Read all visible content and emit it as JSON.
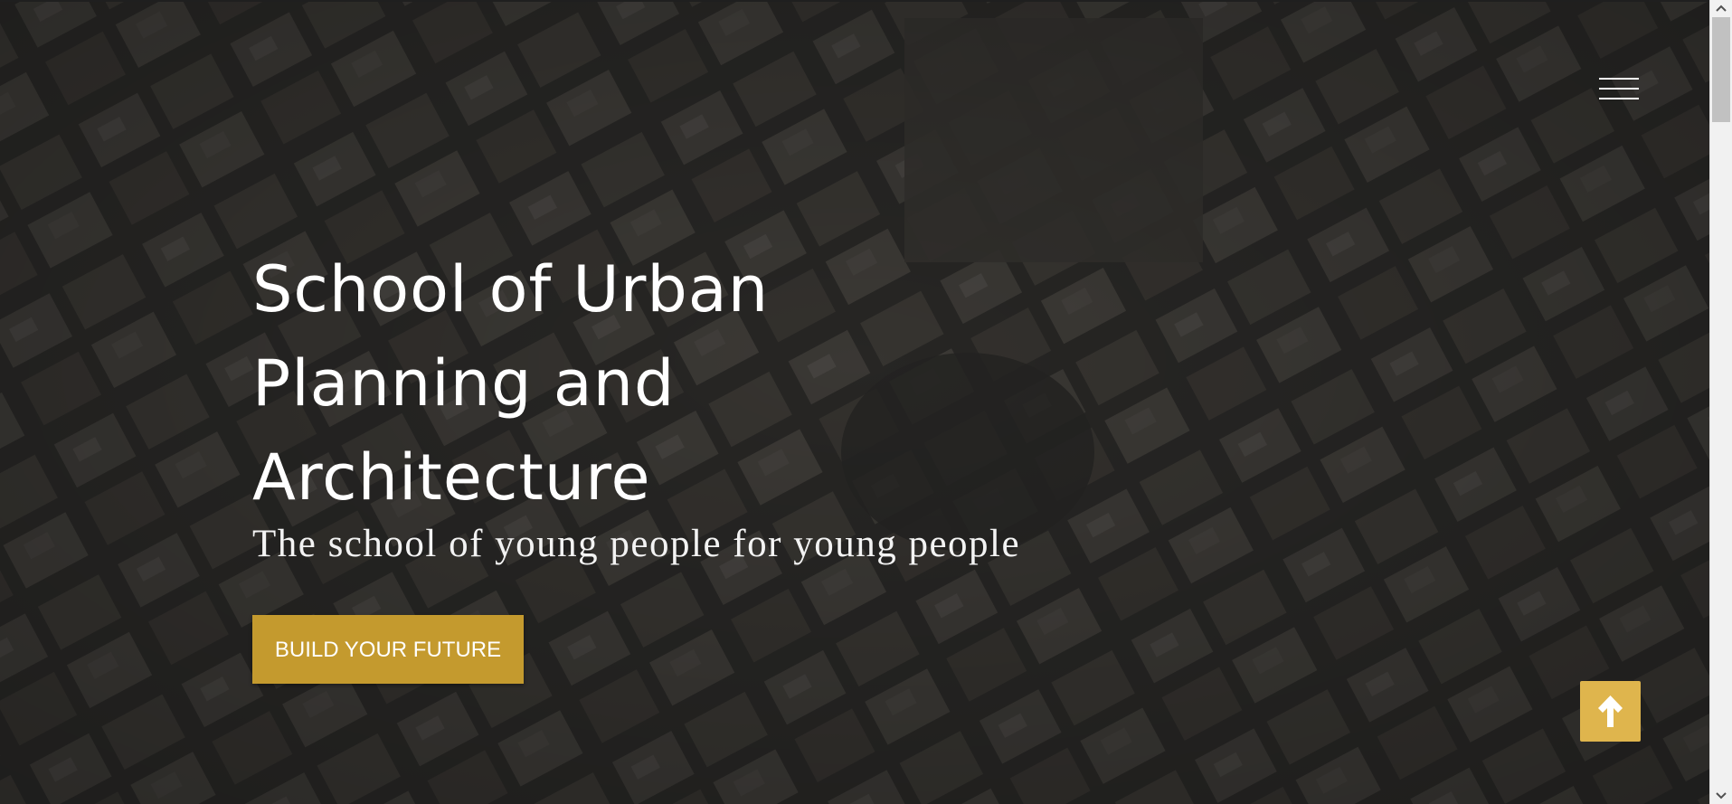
{
  "hero": {
    "title": "School of Urban Planning and Architecture",
    "subtitle": "The school of young people for young people",
    "cta_label": "BUILD YOUR FUTURE"
  },
  "icons": {
    "menu": "hamburger-menu-icon",
    "back_to_top": "arrow-up-icon",
    "scroll_up": "chevron-up-icon",
    "scroll_down": "chevron-down-icon"
  },
  "colors": {
    "accent": "#c49a2e",
    "back_to_top": "#dfb54d",
    "overlay": "#1c1c1c",
    "text": "#ffffff"
  }
}
